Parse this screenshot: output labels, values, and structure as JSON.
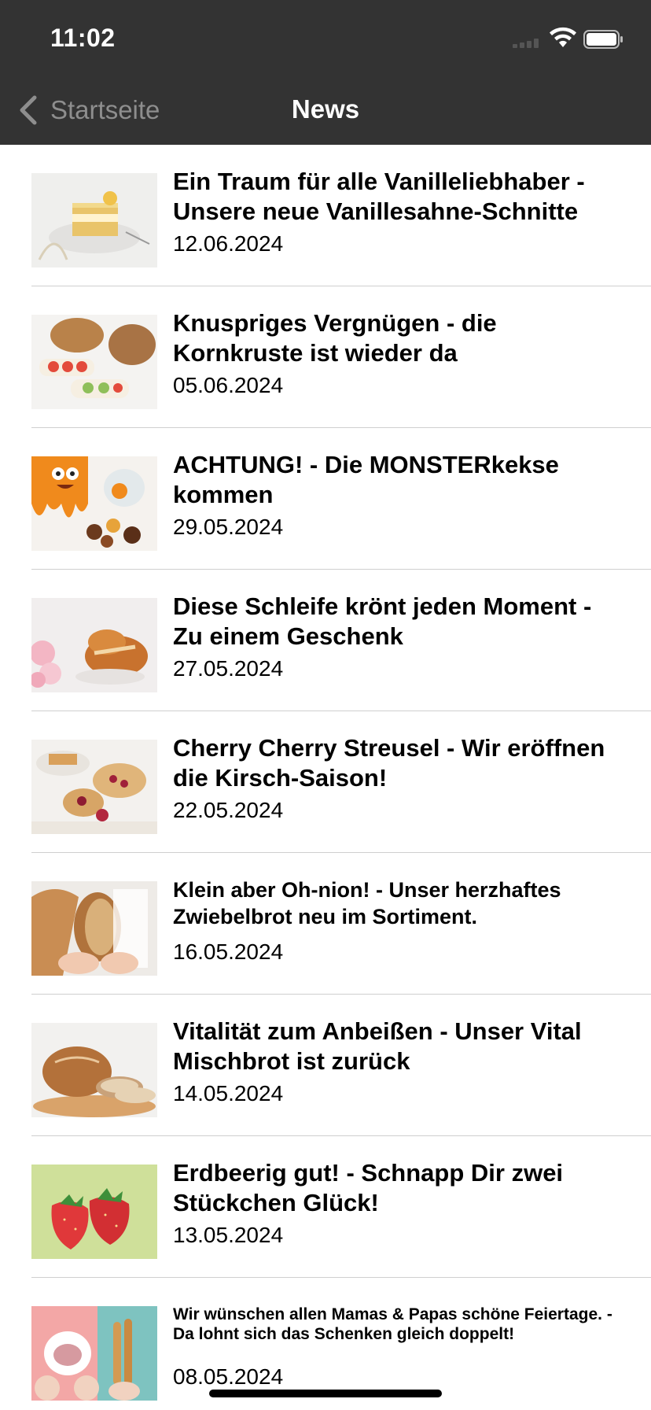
{
  "status_bar": {
    "time": "11:02"
  },
  "nav": {
    "back_label": "Startseite",
    "title": "News"
  },
  "news": [
    {
      "title": "Ein Traum für alle Vanilleliebhaber - Unsere neue Vanillesahne-Schnitte",
      "date": "12.06.2024",
      "image": "vanilla-cake-image"
    },
    {
      "title": "Knuspriges Vergnügen - die Kornkruste ist wieder da",
      "date": "05.06.2024",
      "image": "bread-sandwich-image"
    },
    {
      "title": "ACHTUNG! - Die MONSTERkekse kommen",
      "date": "29.05.2024",
      "image": "monster-cookies-image"
    },
    {
      "title": "Diese Schleife krönt jeden Moment - Zu einem Geschenk",
      "date": "27.05.2024",
      "image": "braided-pastry-image"
    },
    {
      "title": "Cherry Cherry Streusel - Wir eröffnen die Kirsch-Saison!",
      "date": "22.05.2024",
      "image": "cherry-streusel-image"
    },
    {
      "title": "Klein aber Oh-nion! - Unser herzhaftes Zwiebelbrot neu im Sortiment.",
      "date": "16.05.2024",
      "image": "onion-bread-image"
    },
    {
      "title": "Vitalität zum Anbeißen - Unser Vital Mischbrot ist zurück",
      "date": "14.05.2024",
      "image": "mixed-bread-image"
    },
    {
      "title": "Erdbeerig gut! - Schnapp Dir zwei Stückchen Glück!",
      "date": "13.05.2024",
      "image": "strawberries-image"
    },
    {
      "title": "Wir wünschen allen Mamas & Papas schöne Feiertage. - Da lohnt sich das Schenken gleich doppelt!",
      "date": "08.05.2024",
      "image": "gift-pastry-image"
    }
  ],
  "colors": {
    "bar_background": "#333333",
    "back_text": "#8e8e8e",
    "divider": "#cfcfcf"
  }
}
